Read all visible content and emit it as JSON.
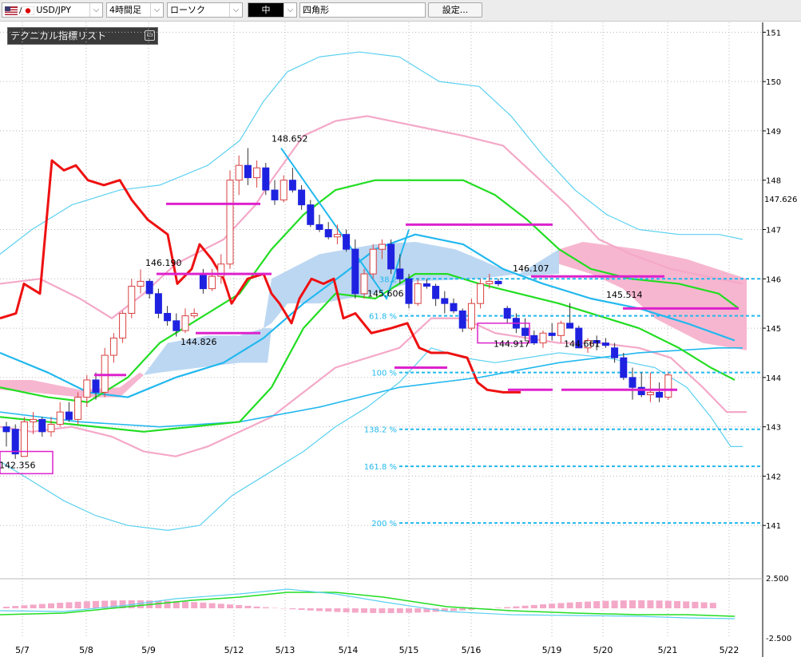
{
  "toolbar": {
    "symbol": "USD/JPY",
    "timeframe": "4時間足",
    "chart_style": "ローソク",
    "size": "中",
    "drawing_tool": "四角形",
    "settings_button": "設定..."
  },
  "indicator_panel": {
    "title": "テクニカル指標リスト",
    "minimize_icon": "minimize-icon"
  },
  "colors": {
    "up_candle": "#d94040",
    "down_candle": "#1e22e0",
    "ichimoku_cloud_up": "#bcd7f2",
    "ichimoku_cloud_down": "#f7b6cf",
    "bollinger_2sigma": "#f4a8c8",
    "bollinger_3sigma": "#5bd0f0",
    "ma_green": "#22dd22",
    "ma_skyblue": "#22b8ee",
    "chikou_red": "#ee1111",
    "fib_lines": "#22b8ee",
    "annotation": "#dd22cc"
  },
  "chart_data": {
    "type": "line",
    "instrument": "USD/JPY",
    "ylim": [
      140.0,
      151.2
    ],
    "yticks": [
      "151",
      "150",
      "149",
      "148",
      "147",
      "146",
      "145",
      "144",
      "143",
      "142",
      "141"
    ],
    "current_price_label": "147.626",
    "x_labels": [
      "5/7",
      "5/8",
      "5/9",
      "5/12",
      "5/13",
      "5/14",
      "5/15",
      "5/16",
      "5/19",
      "5/20",
      "5/21",
      "5/22"
    ],
    "price_labels": [
      "148.652",
      "146.190",
      "144.826",
      "145.606",
      "146.107",
      "144.917",
      "144.661",
      "145.514",
      "142.356"
    ],
    "fib_levels": [
      {
        "label": "38.2",
        "value": 146.0
      },
      {
        "label": "61.8 %",
        "value": 145.25
      },
      {
        "label": "100 %",
        "value": 144.1
      },
      {
        "label": "138.2 %",
        "value": 142.95
      },
      {
        "label": "161.8 %",
        "value": 142.2
      },
      {
        "label": "200 %",
        "value": 141.05
      }
    ],
    "candles": [
      {
        "o": 143.0,
        "h": 143.1,
        "l": 142.6,
        "c": 142.9
      },
      {
        "o": 142.95,
        "h": 143.05,
        "l": 142.35,
        "c": 142.45
      },
      {
        "o": 142.4,
        "h": 143.2,
        "l": 142.4,
        "c": 143.1
      },
      {
        "o": 143.1,
        "h": 143.3,
        "l": 142.85,
        "c": 143.15
      },
      {
        "o": 143.15,
        "h": 143.2,
        "l": 142.8,
        "c": 142.9
      },
      {
        "o": 142.9,
        "h": 143.2,
        "l": 142.8,
        "c": 143.05
      },
      {
        "o": 143.05,
        "h": 143.5,
        "l": 143.0,
        "c": 143.3
      },
      {
        "o": 143.3,
        "h": 143.5,
        "l": 143.1,
        "c": 143.15
      },
      {
        "o": 143.15,
        "h": 143.7,
        "l": 143.05,
        "c": 143.6
      },
      {
        "o": 143.6,
        "h": 144.05,
        "l": 143.4,
        "c": 143.95
      },
      {
        "o": 143.95,
        "h": 144.1,
        "l": 143.55,
        "c": 143.7
      },
      {
        "o": 143.7,
        "h": 144.6,
        "l": 143.6,
        "c": 144.45
      },
      {
        "o": 144.45,
        "h": 144.9,
        "l": 144.3,
        "c": 144.8
      },
      {
        "o": 144.8,
        "h": 145.35,
        "l": 144.7,
        "c": 145.3
      },
      {
        "o": 145.3,
        "h": 146.0,
        "l": 145.2,
        "c": 145.85
      },
      {
        "o": 145.85,
        "h": 146.19,
        "l": 145.7,
        "c": 145.95
      },
      {
        "o": 145.95,
        "h": 146.0,
        "l": 145.6,
        "c": 145.7
      },
      {
        "o": 145.7,
        "h": 145.8,
        "l": 145.2,
        "c": 145.3
      },
      {
        "o": 145.3,
        "h": 145.45,
        "l": 145.05,
        "c": 145.15
      },
      {
        "o": 145.15,
        "h": 145.3,
        "l": 144.83,
        "c": 144.95
      },
      {
        "o": 144.95,
        "h": 145.4,
        "l": 144.9,
        "c": 145.25
      },
      {
        "o": 145.25,
        "h": 145.4,
        "l": 145.2,
        "c": 145.3
      },
      {
        "o": 146.1,
        "h": 146.2,
        "l": 145.7,
        "c": 145.8
      },
      {
        "o": 145.8,
        "h": 146.2,
        "l": 145.75,
        "c": 146.05
      },
      {
        "o": 146.05,
        "h": 146.5,
        "l": 145.9,
        "c": 146.3
      },
      {
        "o": 146.3,
        "h": 148.2,
        "l": 146.2,
        "c": 148.0
      },
      {
        "o": 148.0,
        "h": 148.5,
        "l": 147.7,
        "c": 148.3
      },
      {
        "o": 148.3,
        "h": 148.65,
        "l": 147.9,
        "c": 148.05
      },
      {
        "o": 148.05,
        "h": 148.4,
        "l": 147.85,
        "c": 148.25
      },
      {
        "o": 148.25,
        "h": 148.35,
        "l": 147.7,
        "c": 147.8
      },
      {
        "o": 147.8,
        "h": 148.0,
        "l": 147.5,
        "c": 147.6
      },
      {
        "o": 147.6,
        "h": 148.1,
        "l": 147.55,
        "c": 148.0
      },
      {
        "o": 148.0,
        "h": 148.25,
        "l": 147.75,
        "c": 147.8
      },
      {
        "o": 147.8,
        "h": 147.9,
        "l": 147.4,
        "c": 147.5
      },
      {
        "o": 147.5,
        "h": 147.6,
        "l": 147.05,
        "c": 147.1
      },
      {
        "o": 147.1,
        "h": 147.3,
        "l": 146.95,
        "c": 147.0
      },
      {
        "o": 147.0,
        "h": 147.15,
        "l": 146.8,
        "c": 146.85
      },
      {
        "o": 146.85,
        "h": 147.1,
        "l": 146.7,
        "c": 146.9
      },
      {
        "o": 146.9,
        "h": 147.0,
        "l": 146.55,
        "c": 146.6
      },
      {
        "o": 146.6,
        "h": 146.8,
        "l": 145.6,
        "c": 145.7
      },
      {
        "o": 145.7,
        "h": 146.2,
        "l": 145.6,
        "c": 146.1
      },
      {
        "o": 146.1,
        "h": 146.7,
        "l": 146.0,
        "c": 146.6
      },
      {
        "o": 146.6,
        "h": 146.8,
        "l": 146.4,
        "c": 146.7
      },
      {
        "o": 146.7,
        "h": 146.8,
        "l": 146.1,
        "c": 146.2
      },
      {
        "o": 146.2,
        "h": 146.5,
        "l": 145.9,
        "c": 146.0
      },
      {
        "o": 146.0,
        "h": 146.1,
        "l": 145.4,
        "c": 145.5
      },
      {
        "o": 145.5,
        "h": 146.0,
        "l": 145.45,
        "c": 145.9
      },
      {
        "o": 145.9,
        "h": 146.0,
        "l": 145.8,
        "c": 145.85
      },
      {
        "o": 145.85,
        "h": 145.9,
        "l": 145.45,
        "c": 145.6
      },
      {
        "o": 145.6,
        "h": 145.75,
        "l": 145.3,
        "c": 145.5
      },
      {
        "o": 145.5,
        "h": 145.6,
        "l": 145.3,
        "c": 145.35
      },
      {
        "o": 145.35,
        "h": 145.4,
        "l": 144.92,
        "c": 145.0
      },
      {
        "o": 145.0,
        "h": 145.6,
        "l": 144.95,
        "c": 145.5
      },
      {
        "o": 145.5,
        "h": 146.0,
        "l": 145.4,
        "c": 145.9
      },
      {
        "o": 145.9,
        "h": 146.1,
        "l": 145.8,
        "c": 145.95
      },
      {
        "o": 145.95,
        "h": 146.0,
        "l": 145.85,
        "c": 145.9
      },
      {
        "o": 145.4,
        "h": 145.45,
        "l": 145.1,
        "c": 145.2
      },
      {
        "o": 145.2,
        "h": 145.3,
        "l": 144.9,
        "c": 145.0
      },
      {
        "o": 145.0,
        "h": 145.2,
        "l": 144.75,
        "c": 144.85
      },
      {
        "o": 144.85,
        "h": 144.95,
        "l": 144.66,
        "c": 144.7
      },
      {
        "o": 144.7,
        "h": 144.95,
        "l": 144.6,
        "c": 144.9
      },
      {
        "o": 144.9,
        "h": 145.1,
        "l": 144.75,
        "c": 144.85
      },
      {
        "o": 144.85,
        "h": 145.15,
        "l": 144.7,
        "c": 145.1
      },
      {
        "o": 145.1,
        "h": 145.51,
        "l": 145.0,
        "c": 145.0
      },
      {
        "o": 145.0,
        "h": 145.05,
        "l": 144.6,
        "c": 144.6
      },
      {
        "o": 144.6,
        "h": 144.8,
        "l": 144.5,
        "c": 144.75
      },
      {
        "o": 144.75,
        "h": 144.85,
        "l": 144.55,
        "c": 144.7
      },
      {
        "o": 144.7,
        "h": 144.8,
        "l": 144.6,
        "c": 144.65
      },
      {
        "o": 144.6,
        "h": 144.7,
        "l": 144.3,
        "c": 144.4
      },
      {
        "o": 144.4,
        "h": 144.5,
        "l": 143.95,
        "c": 144.0
      },
      {
        "o": 144.0,
        "h": 144.2,
        "l": 143.55,
        "c": 143.8
      },
      {
        "o": 143.8,
        "h": 144.1,
        "l": 143.6,
        "c": 143.65
      },
      {
        "o": 143.65,
        "h": 144.1,
        "l": 143.5,
        "c": 143.7
      },
      {
        "o": 143.7,
        "h": 143.9,
        "l": 143.5,
        "c": 143.6
      },
      {
        "o": 143.6,
        "h": 144.1,
        "l": 143.55,
        "c": 144.05
      }
    ],
    "bollinger": {
      "upper3": [
        146.9,
        147.3,
        147.7,
        147.9,
        148.4,
        149.2,
        149.9,
        150.2,
        150.4,
        150.6,
        150.7,
        150.6,
        150.5,
        150.2,
        149.8,
        149.1,
        148.0,
        147.2,
        147.1,
        147.0,
        146.8
      ],
      "upper2": [
        145.8,
        146.0,
        146.3,
        146.6,
        147.1,
        147.8,
        148.4,
        148.8,
        149.1,
        149.2,
        149.2,
        149.0,
        148.9,
        148.8,
        148.3,
        147.4,
        146.6,
        146.3,
        146.2,
        146.0,
        145.8
      ],
      "lower2": [
        143.0,
        142.8,
        142.5,
        142.5,
        142.9,
        143.6,
        144.2,
        144.7,
        145.1,
        145.4,
        145.6,
        145.4,
        145.2,
        145.1,
        144.8,
        144.6,
        144.4,
        144.2,
        143.9,
        143.5,
        143.2
      ],
      "lower3": [
        141.9,
        141.6,
        141.3,
        141.1,
        141.5,
        142.2,
        142.7,
        143.1,
        143.5,
        143.8,
        144.0,
        143.8,
        143.6,
        143.4,
        143.2,
        143.0,
        143.0,
        143.4,
        143.3,
        142.8,
        142.6
      ],
      "x_dates": [
        0,
        4,
        8,
        12,
        16,
        20,
        24,
        28,
        32,
        36,
        40,
        44,
        48,
        52,
        56,
        60,
        64,
        68,
        72,
        76,
        78
      ]
    }
  },
  "sub_panel": {
    "ytick_top": "2.500",
    "ytick_bottom": "-2.500"
  }
}
